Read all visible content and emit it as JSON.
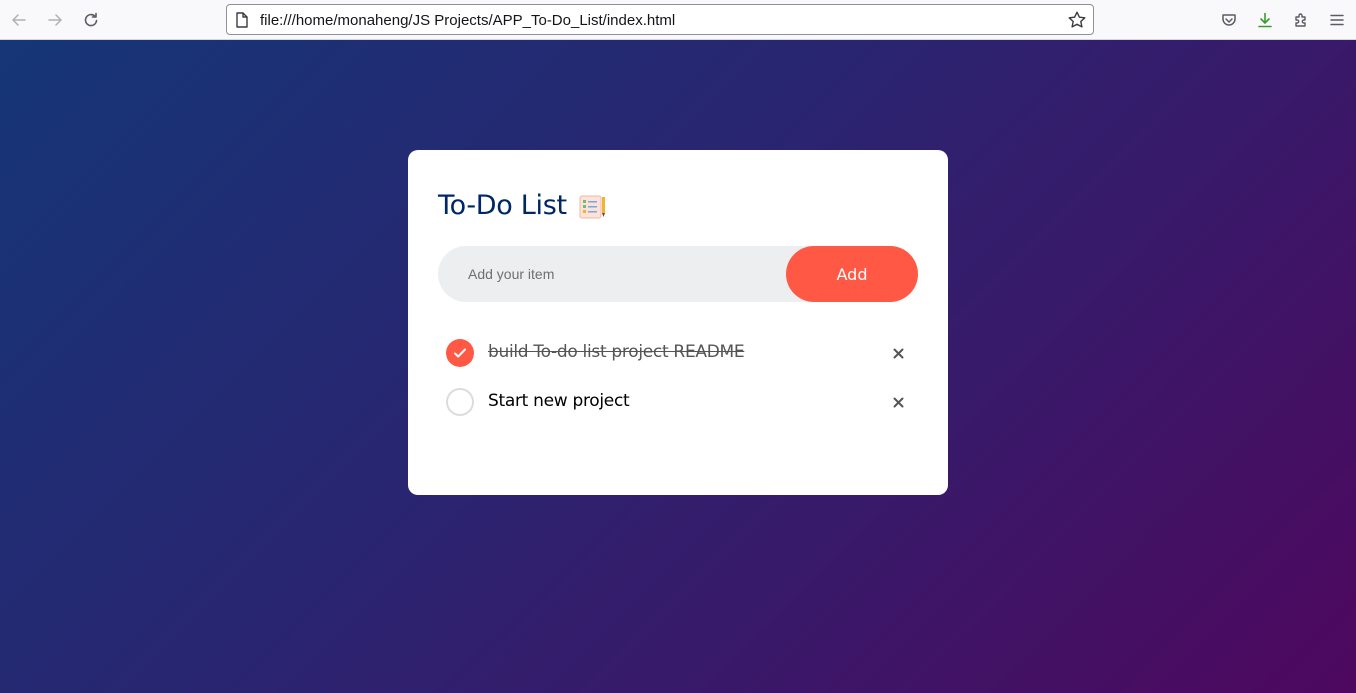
{
  "browser": {
    "url": "file:///home/monaheng/JS Projects/APP_To-Do_List/index.html",
    "icons": {
      "back": "arrow-left-icon",
      "forward": "arrow-right-icon",
      "reload": "reload-icon",
      "page": "page-icon",
      "bookmark": "star-icon",
      "pocket": "pocket-icon",
      "downloads": "download-icon",
      "extensions": "puzzle-icon",
      "menu": "hamburger-icon"
    },
    "download_color": "#3c9b2e"
  },
  "app": {
    "title": "To-Do List",
    "title_icon": "notepad-icon",
    "input_placeholder": "Add your item",
    "add_label": "Add",
    "accent_color": "#ff5945",
    "title_color": "#002765",
    "tasks": [
      {
        "text": "build To-do list project README",
        "done": true
      },
      {
        "text": "Start new project",
        "done": false
      }
    ]
  },
  "background": {
    "from": "#153677",
    "to": "#4e085f"
  }
}
